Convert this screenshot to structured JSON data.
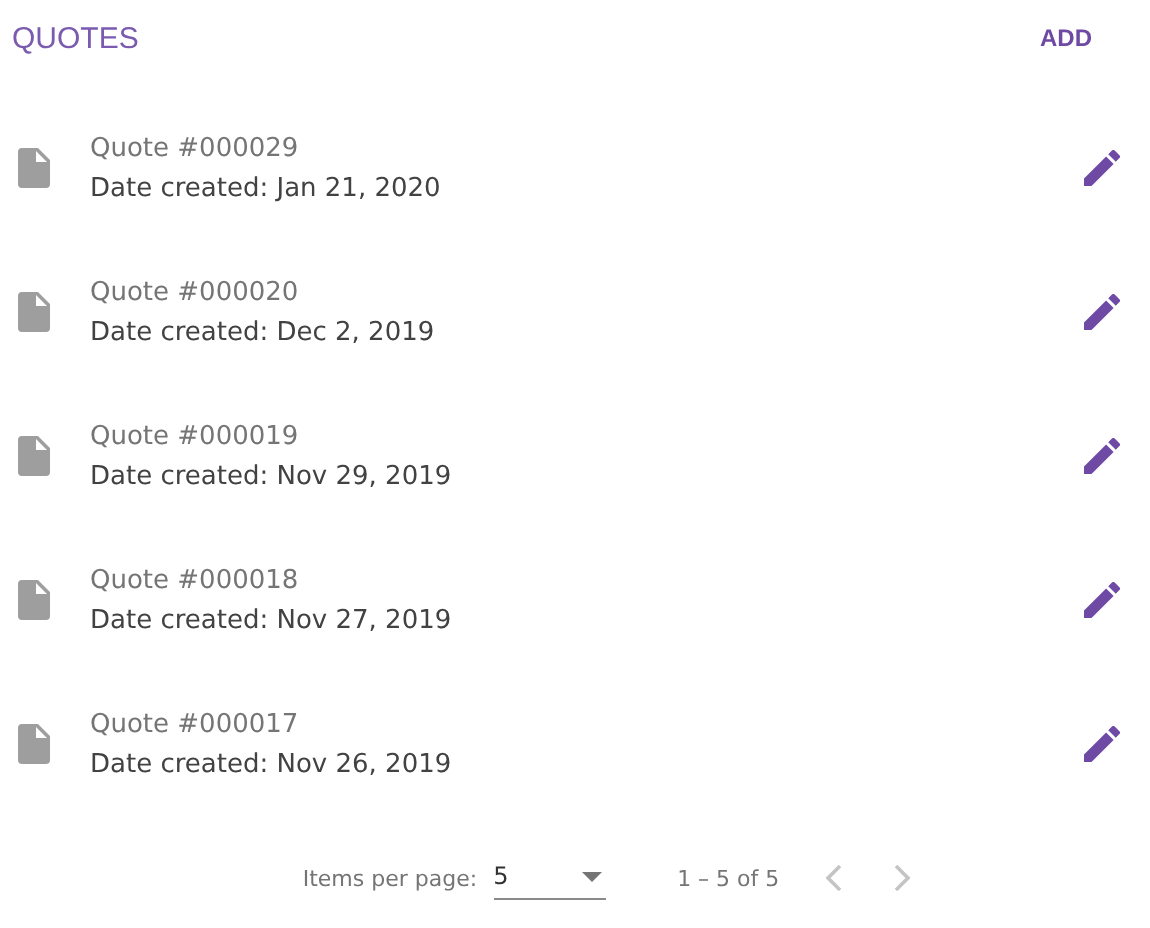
{
  "header": {
    "title": "QUOTES",
    "action": "ADD"
  },
  "quotes": [
    {
      "title": "Quote #000029",
      "date": "Date created: Jan 21, 2020"
    },
    {
      "title": "Quote #000020",
      "date": "Date created: Dec 2, 2019"
    },
    {
      "title": "Quote #000019",
      "date": "Date created: Nov 29, 2019"
    },
    {
      "title": "Quote #000018",
      "date": "Date created: Nov 27, 2019"
    },
    {
      "title": "Quote #000017",
      "date": "Date created: Nov 26, 2019"
    }
  ],
  "paginator": {
    "label": "Items per page:",
    "page_size": "5",
    "range": "1 – 5 of 5",
    "previous_disabled": true,
    "next_disabled": true
  }
}
